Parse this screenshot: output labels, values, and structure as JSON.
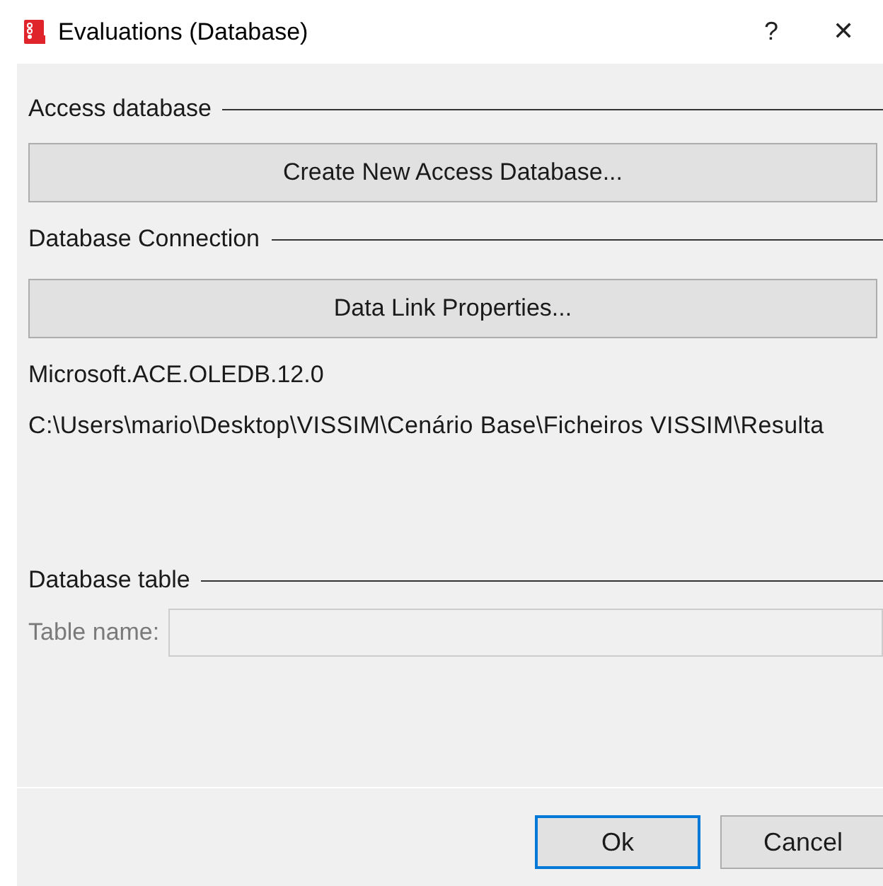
{
  "window": {
    "title": "Evaluations (Database)",
    "help": "?",
    "close": "✕"
  },
  "sections": [
    {
      "heading": "Access database",
      "button": "Create New Access Database..."
    },
    {
      "heading": "Database Connection",
      "button": "Data Link Properties..."
    }
  ],
  "connection": {
    "provider": "Microsoft.ACE.OLEDB.12.0",
    "path": "C:\\Users\\mario\\Desktop\\VISSIM\\Cenário Base\\Ficheiros VISSIM\\Resulta"
  },
  "table_section": {
    "heading": "Database table",
    "label": "Table name:",
    "disabled": true
  },
  "buttons": [
    {
      "label": "Ok",
      "default": true
    },
    {
      "label": "Cancel",
      "default": false
    }
  ]
}
